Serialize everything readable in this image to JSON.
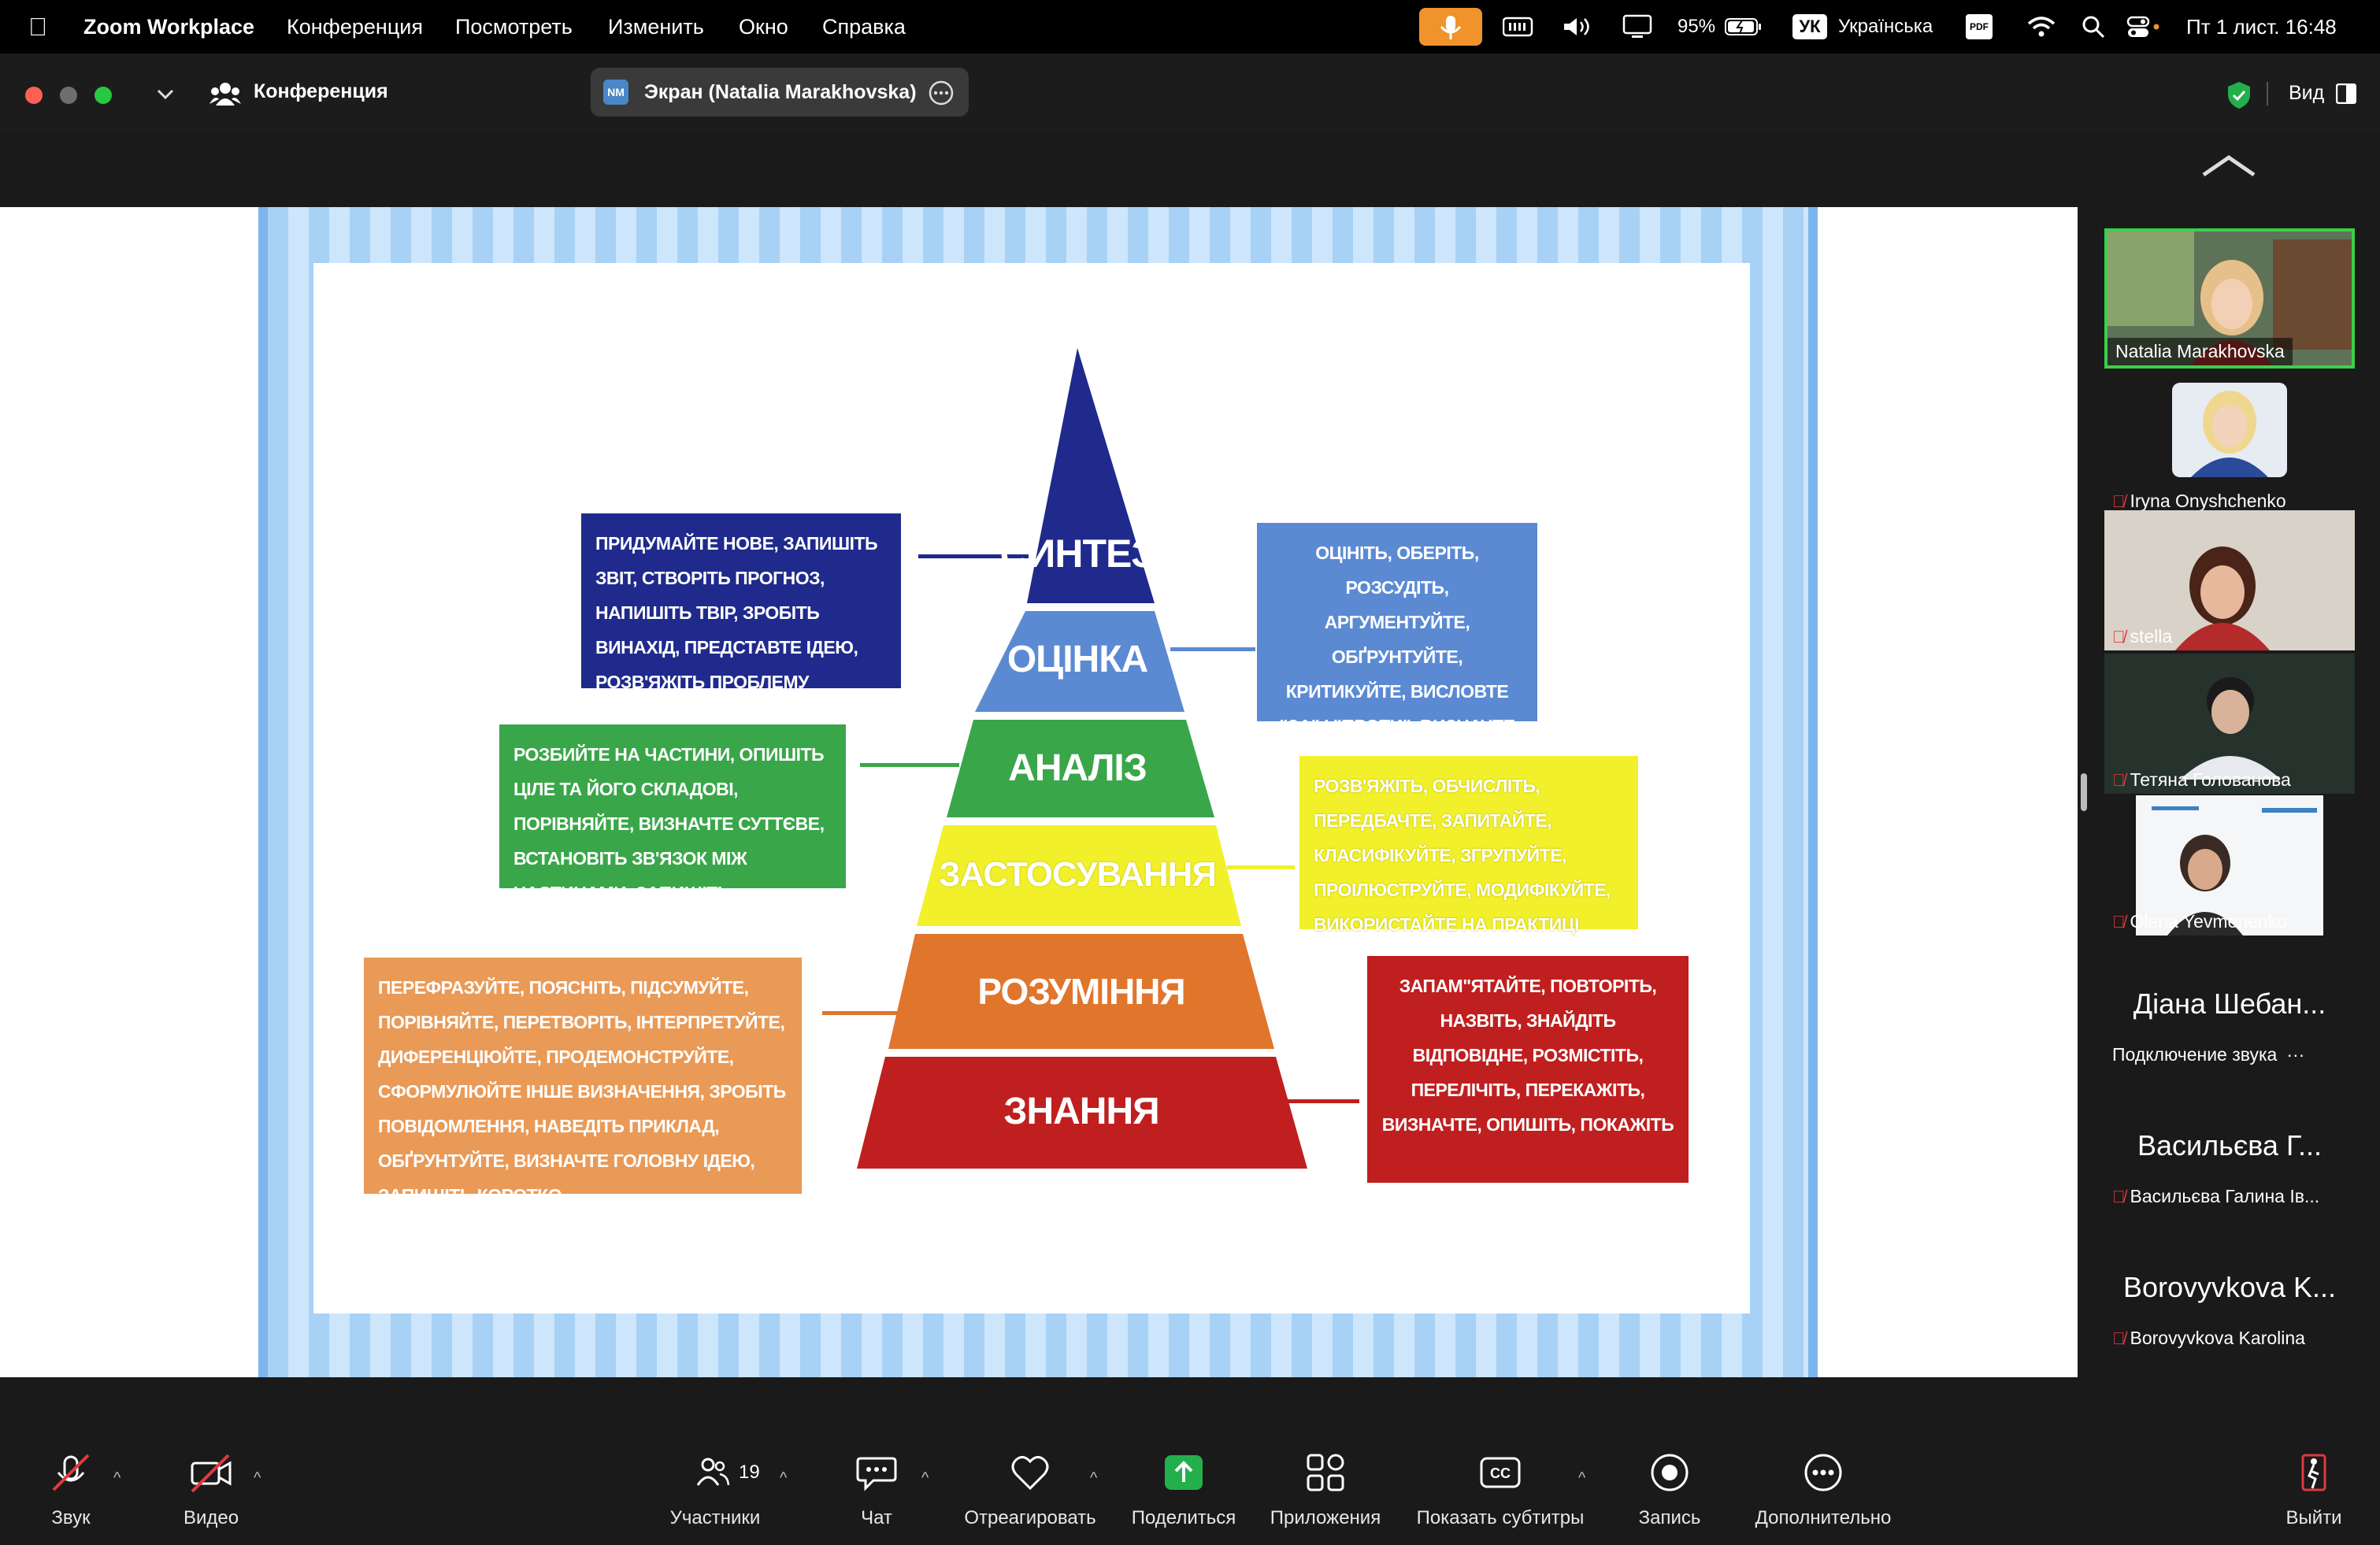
{
  "menubar": {
    "app_name": "Zoom Workplace",
    "menus": [
      "Конференция",
      "Посмотреть",
      "Изменить",
      "Окно",
      "Справка"
    ],
    "battery": "95%",
    "input_source": "УК",
    "language": "Українська",
    "pdf_badge": "PDF",
    "datetime": "Пт 1 лист.  16:48"
  },
  "titlebar": {
    "meeting_label": "Конференция",
    "share_badge": "NM",
    "share_label": "Экран (Natalia Marakhovska)",
    "view_label": "Вид"
  },
  "slide": {
    "pyramid": [
      {
        "label": "СИНТЕЗ",
        "color": "#1f2a8c"
      },
      {
        "label": "ОЦІНКА",
        "color": "#5b8ad3"
      },
      {
        "label": "АНАЛІЗ",
        "color": "#3aa64a"
      },
      {
        "label": "ЗАСТОСУВАННЯ",
        "color": "#f2f02a"
      },
      {
        "label": "РОЗУМІННЯ",
        "color": "#e0752c"
      },
      {
        "label": "ЗНАННЯ",
        "color": "#c01f1f"
      }
    ],
    "boxes": {
      "synthesis": "ПРИДУМАЙТЕ НОВЕ, ЗАПИШІТЬ ЗВІТ, СТВОРІТЬ ПРОГНОЗ, НАПИШІТЬ ТВІР, ЗРОБІТЬ ВИНАХІД, ПРЕДСТАВТЕ ІДЕЮ, РОЗВ'ЯЖІТЬ ПРОБЛЕМУ",
      "evaluation": "ОЦІНІТЬ, ОБЕРІТЬ, РОЗСУДІТЬ, АРГУМЕНТУЙТЕ, ОБҐРУНТУЙТЕ, КРИТИКУЙТЕ, ВИСЛОВТЕ \"ЗА\" І \"ПРОТИ\", ВИЗНАЧТЕ ПРІОРІТЕТИ, ДИСКУТУЙТЕ",
      "analysis": "РОЗБИЙТЕ НА ЧАСТИНИ, ОПИШІТЬ ЦІЛЕ ТА ЙОГО СКЛАДОВІ, ПОРІВНЯЙТЕ, ВИЗНАЧТЕ СУТТЄВЕ, ВСТАНОВІТЬ ЗВ'ЯЗОК МІЖ ЧАСТИНАМИ, ЗАПИШІТЬ ВЛАСТИВІСТЬ",
      "application": "РОЗВ'ЯЖІТЬ, ОБЧИСЛІТЬ, ПЕРЕДБАЧТЕ, ЗАПИТАЙТЕ, КЛАСИФІКУЙТЕ, ЗГРУПУЙТЕ, ПРОІЛЮСТРУЙТЕ, МОДИФІКУЙТЕ, ВИКОРИСТАЙТЕ НА ПРАКТИЦІ",
      "understanding": "ПЕРЕФРАЗУЙТЕ, ПОЯСНІТЬ, ПІДСУМУЙТЕ, ПОРІВНЯЙТЕ, ПЕРЕТВОРІТЬ, ІНТЕРПРЕТУЙТЕ, ДИФЕРЕНЦІЮЙТЕ, ПРОДЕМОНСТРУЙТЕ, СФОРМУЛЮЙТЕ ІНШЕ ВИЗНАЧЕННЯ, ЗРОБІТЬ ПОВІДОМЛЕННЯ, НАВЕДІТЬ ПРИКЛАД, ОБҐРУНТУЙТЕ, ВИЗНАЧТЕ ГОЛОВНУ ІДЕЮ, ЗАПИШІТЬ КОРОТКО",
      "knowledge": "ЗАПАМ\"ЯТАЙТЕ, ПОВТОРІТЬ, НАЗВІТЬ, ЗНАЙДІТЬ ВІДПОВІДНЕ, РОЗМІСТІТЬ, ПЕРЕЛІЧІТЬ, ПЕРЕКАЖІТЬ, ВИЗНАЧТЕ, ОПИШІТЬ, ПОКАЖІТЬ"
    }
  },
  "participants": [
    {
      "name": "Natalia Marakhovska",
      "muted": false,
      "active": true
    },
    {
      "name": "Iryna Onyshchenko",
      "muted": true
    },
    {
      "name": "stella",
      "muted": true
    },
    {
      "name": "Тетяна Голованова",
      "muted": true
    },
    {
      "name": "Olena Yevmenenko",
      "muted": true
    }
  ],
  "participants_no_video": [
    {
      "display": "Діана Шебан...",
      "sub": "Подключение звука"
    },
    {
      "display": "Васильєва Г...",
      "sub": "Васильєва Галина Ів..."
    },
    {
      "display": "Borovyvkova K...",
      "sub": "Borovyvkova Karolina"
    }
  ],
  "toolbar": {
    "audio": "Звук",
    "video": "Видео",
    "participants": "Участники",
    "participants_count": "19",
    "chat": "Чат",
    "react": "Отреагировать",
    "share": "Поделиться",
    "apps": "Приложения",
    "captions": "Показать субтитры",
    "record": "Запись",
    "more": "Дополнительно",
    "leave": "Выйти"
  }
}
